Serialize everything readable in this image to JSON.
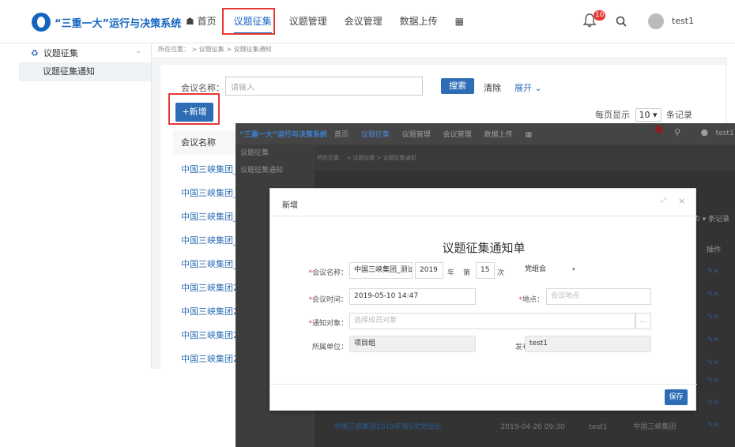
{
  "app": {
    "title": "“三重一大”运行与决策系统"
  },
  "nav": {
    "home": "首页",
    "issue_collect": "议题征集",
    "issue_manage": "议题管理",
    "meeting_manage": "会议管理",
    "data_upload": "数据上传"
  },
  "header": {
    "notification_count": "10",
    "username": "test1"
  },
  "sidebar": {
    "group": "议题征集",
    "item": "议题征集通知"
  },
  "breadcrumb": "所在位置：  >  议题征集  >  议题征集通知",
  "search": {
    "label": "会议名称：",
    "placeholder": "请输入",
    "search_label": "搜索",
    "clear_label": "清除",
    "expand_label": "展开"
  },
  "toolbar": {
    "add_label": "+新增"
  },
  "pagination": {
    "prefix": "每页显示",
    "size": "10",
    "suffix": "条记录"
  },
  "table": {
    "header": "会议名称",
    "rows": [
      "中国三峡集团_",
      "中国三峡集团_",
      "中国三峡集团_",
      "中国三峡集团_",
      "中国三峡集团_",
      "中国三峡集团2",
      "中国三峡集团2",
      "中国三峡集团2",
      "中国三峡集团2"
    ]
  },
  "overlay": {
    "title": "“三重一大”运行与决策系统",
    "nav": [
      "首页",
      "议题征集",
      "议题管理",
      "会议管理",
      "数据上传"
    ],
    "username": "test1",
    "sidebar_group": "议题征集",
    "sidebar_item": "议题征集通知",
    "breadcrumb": "所在位置：  >  议题征集  >  议题征集通知",
    "page_size_text": "0 ▾  条记录",
    "op_header": "操作",
    "bottom_row": {
      "name": "中国三峡集团2019年第5次党组会",
      "time": "2019-04-26 09:30",
      "user": "test1",
      "unit": "中国三峡集团"
    }
  },
  "modal": {
    "title": "新增",
    "form_title": "议题征集通知单",
    "meeting_name_label": "会议名称：",
    "meeting_name_value": "中国三峡集团_测试",
    "year_value": "2019",
    "year_unit": "年",
    "times_prefix": "第",
    "times_value": "15",
    "times_unit": "次",
    "meeting_type_value": "党组会",
    "meeting_time_label": "会议时间：",
    "meeting_time_value": "2019-05-10 14:47",
    "location_label": "地点：",
    "location_placeholder": "会议地点",
    "notify_target_label": "通知对象：",
    "notify_target_placeholder": "选择成员对象",
    "unit_label": "所属单位：",
    "unit_value": "项目组",
    "publisher_label": "发布人：",
    "publisher_value": "test1",
    "save_label": "保存"
  }
}
